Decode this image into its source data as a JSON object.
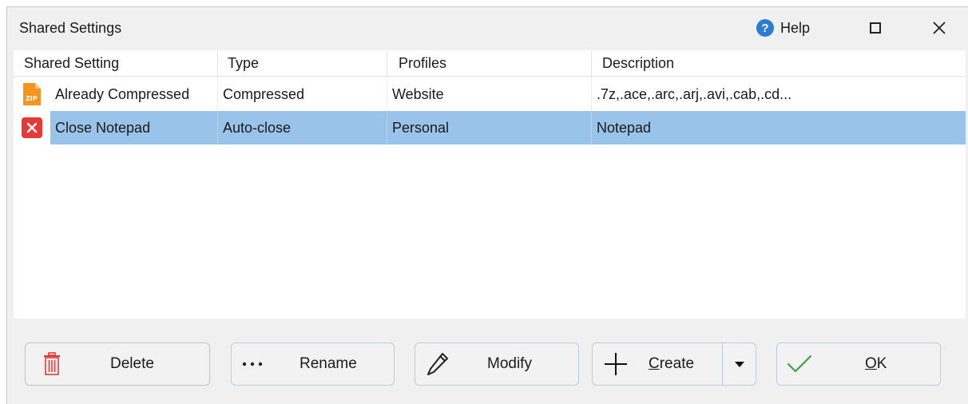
{
  "window": {
    "title": "Shared Settings",
    "help_label": "Help"
  },
  "table": {
    "columns": [
      "Shared Setting",
      "Type",
      "Profiles",
      "Description"
    ],
    "rows": [
      {
        "icon": "zip-file-icon",
        "name": "Already Compressed",
        "type": "Compressed",
        "profiles": "Website",
        "description": ".7z,.ace,.arc,.arj,.avi,.cab,.cd...",
        "selected": false
      },
      {
        "icon": "red-x-icon",
        "name": "Close Notepad",
        "type": "Auto-close",
        "profiles": "Personal",
        "description": "Notepad",
        "selected": true
      }
    ]
  },
  "buttons": {
    "delete_label": "Delete",
    "rename_label": "Rename",
    "modify_label": "Modify",
    "create_label_accel": "C",
    "create_label_rest": "reate",
    "ok_label_accel": "O",
    "ok_label_rest": "K"
  },
  "colors": {
    "selection": "#9ac3e9",
    "help_icon": "#2b7cd3",
    "delete_icon": "#e53935",
    "ok_check": "#3aa04a",
    "zip_icon": "#f5941e"
  }
}
